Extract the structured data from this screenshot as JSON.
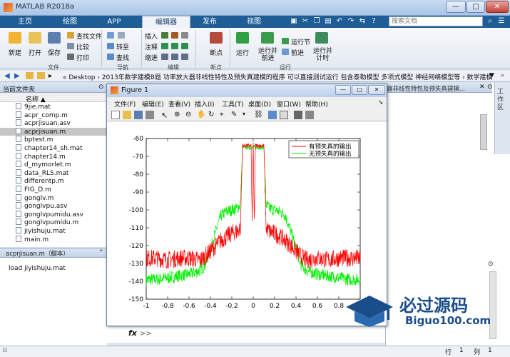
{
  "window": {
    "title": "MATLAB R2018a",
    "buttons": [
      "—",
      "□",
      "✕"
    ]
  },
  "tabs": [
    {
      "label": "主页",
      "active": false
    },
    {
      "label": "绘图",
      "active": false
    },
    {
      "label": "APP",
      "active": false
    },
    {
      "label": "编辑器",
      "active": true
    },
    {
      "label": "发布",
      "active": false
    },
    {
      "label": "视图",
      "active": false
    }
  ],
  "search": {
    "placeholder": "搜索文档"
  },
  "ribbon": {
    "file_group": {
      "label": "文件",
      "new": "新建",
      "open": "打开",
      "save": "保存",
      "find_files": "查找文件",
      "compare": "比较",
      "print": "打印"
    },
    "nav_group": {
      "label": "导航",
      "goto": "转至",
      "find": "查找"
    },
    "edit_group": {
      "label": "编辑",
      "insert": "插入",
      "comment": "注释",
      "indent": "缩进"
    },
    "breakpoint_group": {
      "label": "断点",
      "breakpoints": "断点"
    },
    "run_group": {
      "label": "运行",
      "run": "运行",
      "run_advance": "运行并\n前进",
      "run_section": "运行节",
      "advance": "前进",
      "run_time": "运行并\n计时"
    }
  },
  "address": {
    "path": "« Desktop › 2013年数学建模B题 功率放大器非线性特性及预失真建模的程序 可以直接测试运行 包含泰勒模型 多项式模型 神经网络模型等 › 数学建模"
  },
  "current_folder": {
    "title": "当前文件夹",
    "column": "名称 ▲",
    "files": [
      {
        "name": "9jie.mat",
        "selected": false
      },
      {
        "name": "acpr_comp.m",
        "selected": false
      },
      {
        "name": "acprjisuan.asv",
        "selected": false
      },
      {
        "name": "acprjisuan.m",
        "selected": true
      },
      {
        "name": "bptest.m",
        "selected": false
      },
      {
        "name": "chapter14_sh.mat",
        "selected": false
      },
      {
        "name": "chapter14.m",
        "selected": false
      },
      {
        "name": "d_mymorlet.m",
        "selected": false
      },
      {
        "name": "data_RLS.mat",
        "selected": false
      },
      {
        "name": "differentp.m",
        "selected": false
      },
      {
        "name": "FIG_D.m",
        "selected": false
      },
      {
        "name": "gonglv.m",
        "selected": false
      },
      {
        "name": "gonglvpu.asv",
        "selected": false
      },
      {
        "name": "gonglvpumidu.asv",
        "selected": false
      },
      {
        "name": "gonglvpumidu.m",
        "selected": false
      },
      {
        "name": "jiyishuju.mat",
        "selected": false
      },
      {
        "name": "main.m",
        "selected": false
      }
    ]
  },
  "details": {
    "title": "acprjisuan.m（脚本）",
    "content": "load jiyishuju.mat"
  },
  "right_panel": {
    "header": "器非线性特性及预失真建模...",
    "workspace": "工作区"
  },
  "command": {
    "fx": "fx",
    "prompt": ">>"
  },
  "status": {
    "row_label": "行",
    "row": "1",
    "col_label": "列",
    "col": "1"
  },
  "figure": {
    "title": "Figure 1",
    "menus": [
      "文件(F)",
      "编辑(E)",
      "查看(V)",
      "插入(I)",
      "工具(T)",
      "桌面(D)",
      "窗口(W)",
      "帮助(H)"
    ]
  },
  "watermark": {
    "text": "必过源码",
    "sub": "Biguo100.com"
  },
  "chart_data": {
    "type": "line",
    "xlim": [
      -1,
      1
    ],
    "ylim": [
      -150,
      -60
    ],
    "xticks": [
      "-1",
      "-0.8",
      "-0.6",
      "-0.4",
      "-0.2",
      "0",
      "0.2",
      "0.4",
      "0.6",
      "0.8",
      "1"
    ],
    "yticks": [
      "-60",
      "-70",
      "-80",
      "-90",
      "-100",
      "-110",
      "-120",
      "-130",
      "-140",
      "-150"
    ],
    "legend_position": "top-right",
    "series": [
      {
        "name": "有预失真的输出",
        "color": "#ff0000",
        "points": [
          [
            -1,
            -127
          ],
          [
            -0.9,
            -127
          ],
          [
            -0.8,
            -128
          ],
          [
            -0.7,
            -127
          ],
          [
            -0.6,
            -127
          ],
          [
            -0.5,
            -128
          ],
          [
            -0.45,
            -126
          ],
          [
            -0.4,
            -123
          ],
          [
            -0.35,
            -120
          ],
          [
            -0.3,
            -117
          ],
          [
            -0.25,
            -115
          ],
          [
            -0.2,
            -113
          ],
          [
            -0.15,
            -112
          ],
          [
            -0.12,
            -110
          ],
          [
            -0.1,
            -64
          ],
          [
            -0.02,
            -64
          ],
          [
            -0.01,
            -108
          ],
          [
            0,
            -63
          ],
          [
            0.01,
            -108
          ],
          [
            0.02,
            -64
          ],
          [
            0.1,
            -64
          ],
          [
            0.12,
            -110
          ],
          [
            0.15,
            -112
          ],
          [
            0.2,
            -113
          ],
          [
            0.25,
            -115
          ],
          [
            0.3,
            -117
          ],
          [
            0.35,
            -120
          ],
          [
            0.4,
            -123
          ],
          [
            0.45,
            -126
          ],
          [
            0.5,
            -128
          ],
          [
            0.6,
            -127
          ],
          [
            0.7,
            -128
          ],
          [
            0.8,
            -127
          ],
          [
            0.9,
            -127
          ],
          [
            1,
            -127
          ]
        ]
      },
      {
        "name": "无预失真的输出",
        "color": "#00ee00",
        "points": [
          [
            -1,
            -139
          ],
          [
            -0.9,
            -139
          ],
          [
            -0.8,
            -138
          ],
          [
            -0.7,
            -137
          ],
          [
            -0.6,
            -136
          ],
          [
            -0.5,
            -134
          ],
          [
            -0.45,
            -131
          ],
          [
            -0.4,
            -122
          ],
          [
            -0.35,
            -112
          ],
          [
            -0.3,
            -103
          ],
          [
            -0.25,
            -101
          ],
          [
            -0.2,
            -100
          ],
          [
            -0.15,
            -99
          ],
          [
            -0.12,
            -97
          ],
          [
            -0.1,
            -65
          ],
          [
            0.1,
            -65
          ],
          [
            0.12,
            -97
          ],
          [
            0.15,
            -99
          ],
          [
            0.2,
            -100
          ],
          [
            0.25,
            -101
          ],
          [
            0.3,
            -103
          ],
          [
            0.35,
            -112
          ],
          [
            0.4,
            -122
          ],
          [
            0.45,
            -131
          ],
          [
            0.5,
            -134
          ],
          [
            0.6,
            -136
          ],
          [
            0.7,
            -137
          ],
          [
            0.8,
            -138
          ],
          [
            0.9,
            -139
          ],
          [
            1,
            -139
          ]
        ]
      }
    ]
  }
}
